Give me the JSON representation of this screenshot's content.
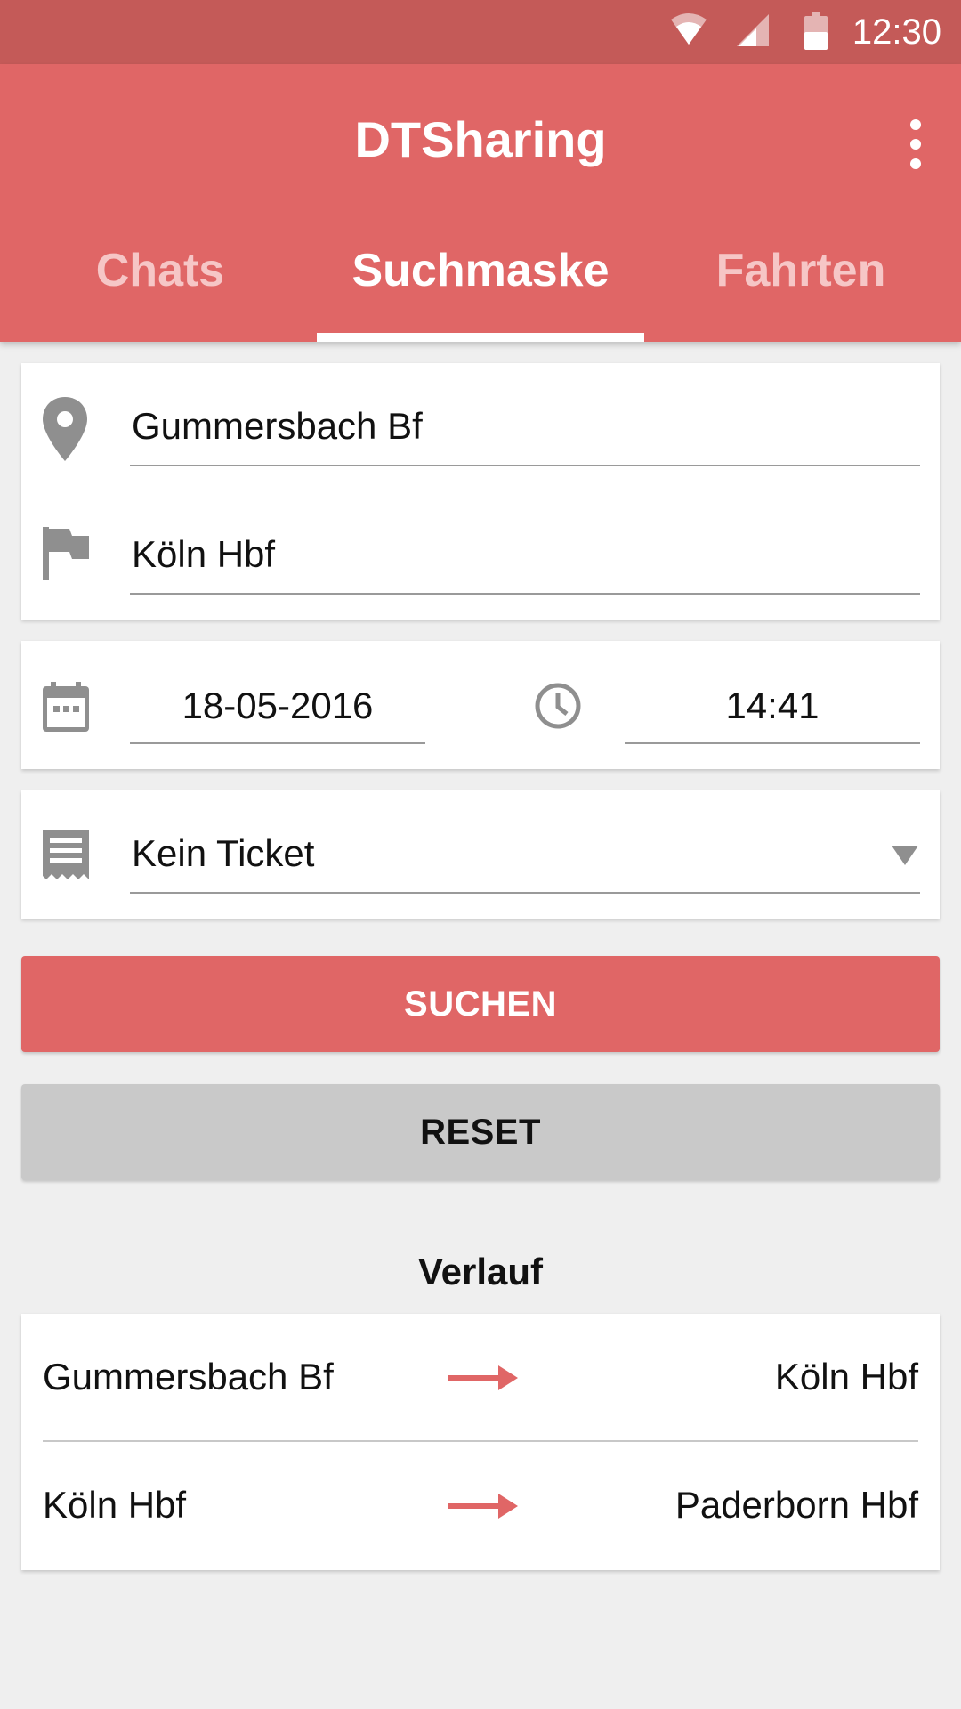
{
  "status_bar": {
    "time": "12:30",
    "icons": [
      "wifi-icon",
      "cell-signal-icon",
      "battery-icon"
    ]
  },
  "app_bar": {
    "title": "DTSharing",
    "menu_icon": "overflow-menu-icon"
  },
  "tabs": [
    {
      "label": "Chats",
      "active": false
    },
    {
      "label": "Suchmaske",
      "active": true
    },
    {
      "label": "Fahrten",
      "active": false
    }
  ],
  "search_form": {
    "from": {
      "value": "Gummersbach Bf",
      "icon": "location-pin-icon"
    },
    "to": {
      "value": "Köln Hbf",
      "icon": "flag-icon"
    },
    "date": {
      "value": "18-05-2016",
      "icon": "calendar-icon"
    },
    "time": {
      "value": "14:41",
      "icon": "clock-icon"
    },
    "ticket": {
      "value": "Kein Ticket",
      "icon": "ticket-icon"
    },
    "search_button": "SUCHEN",
    "reset_button": "RESET"
  },
  "history": {
    "title": "Verlauf",
    "items": [
      {
        "from": "Gummersbach Bf",
        "to": "Köln Hbf"
      },
      {
        "from": "Köln Hbf",
        "to": "Paderborn Hbf"
      }
    ]
  },
  "colors": {
    "primary": "#e06666",
    "primary_dark": "#c45a58",
    "background": "#efefef",
    "icon_gray": "#8f8f8f",
    "reset_button": "#c9c9c9"
  }
}
